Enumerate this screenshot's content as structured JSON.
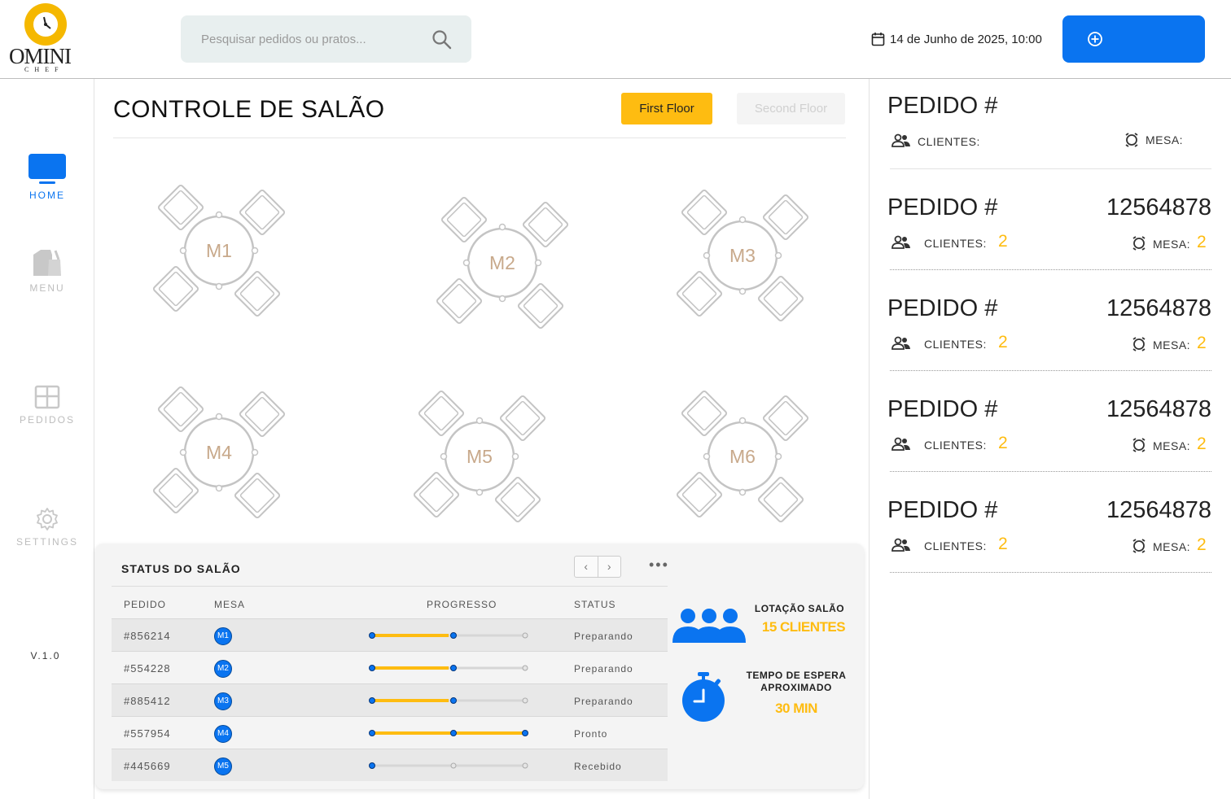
{
  "app": {
    "logo_text": "OMINI",
    "logo_sub": "CHEF",
    "version": "V.1.0"
  },
  "header": {
    "search_placeholder": "Pesquisar pedidos ou pratos...",
    "date": "14 de Junho de 2025, 10:00",
    "new_button_label": ""
  },
  "sidebar": {
    "items": [
      {
        "label": "HOME",
        "icon": "monitor-icon",
        "active": true
      },
      {
        "label": "MENU",
        "icon": "menu-bag-icon",
        "active": false
      },
      {
        "label": "PEDIDOS",
        "icon": "grid-icon",
        "active": false
      },
      {
        "label": "SETTINGS",
        "icon": "gear-icon",
        "active": false
      }
    ]
  },
  "main": {
    "title": "CONTROLE DE SALÃO",
    "floor_tabs": [
      "First Floor",
      "Second Floor"
    ],
    "tables": [
      "M1",
      "M2",
      "M3",
      "M4",
      "M5",
      "M6"
    ]
  },
  "status": {
    "title": "STATUS DO SALÃO",
    "columns": [
      "PEDIDO",
      "MESA",
      "PROGRESSO",
      "STATUS"
    ],
    "rows": [
      {
        "pedido": "#856214",
        "mesa": "M1",
        "progress": 0.5,
        "status": "Preparando"
      },
      {
        "pedido": "#554228",
        "mesa": "M2",
        "progress": 0.5,
        "status": "Preparando"
      },
      {
        "pedido": "#885412",
        "mesa": "M3",
        "progress": 0.5,
        "status": "Preparando"
      },
      {
        "pedido": "#557954",
        "mesa": "M4",
        "progress": 1.0,
        "status": "Pronto"
      },
      {
        "pedido": "#445669",
        "mesa": "M5",
        "progress": 0.0,
        "status": "Recebido"
      }
    ],
    "occupancy_label": "LOTAÇÃO SALÃO",
    "occupancy_value": "15 CLIENTES",
    "wait_label_1": "TEMPO DE ESPERA",
    "wait_label_2": "APROXIMADO",
    "wait_value": "30 MIN"
  },
  "orders": {
    "header": {
      "label": "PEDIDO #",
      "clients_label": "CLIENTES:",
      "table_label": "MESA:"
    },
    "items": [
      {
        "label": "PEDIDO #",
        "number": "12564878",
        "clients_label": "CLIENTES:",
        "clients": "2",
        "table_label": "MESA:",
        "table": "2"
      },
      {
        "label": "PEDIDO #",
        "number": "12564878",
        "clients_label": "CLIENTES:",
        "clients": "2",
        "table_label": "MESA:",
        "table": "2"
      },
      {
        "label": "PEDIDO #",
        "number": "12564878",
        "clients_label": "CLIENTES:",
        "clients": "2",
        "table_label": "MESA:",
        "table": "2"
      },
      {
        "label": "PEDIDO #",
        "number": "12564878",
        "clients_label": "CLIENTES:",
        "clients": "2",
        "table_label": "MESA:",
        "table": "2"
      }
    ]
  },
  "colors": {
    "primary": "#0A74F0",
    "accent": "#FEBC11",
    "table_label": "#C8A98B",
    "table_line": "#c4c4c4"
  }
}
